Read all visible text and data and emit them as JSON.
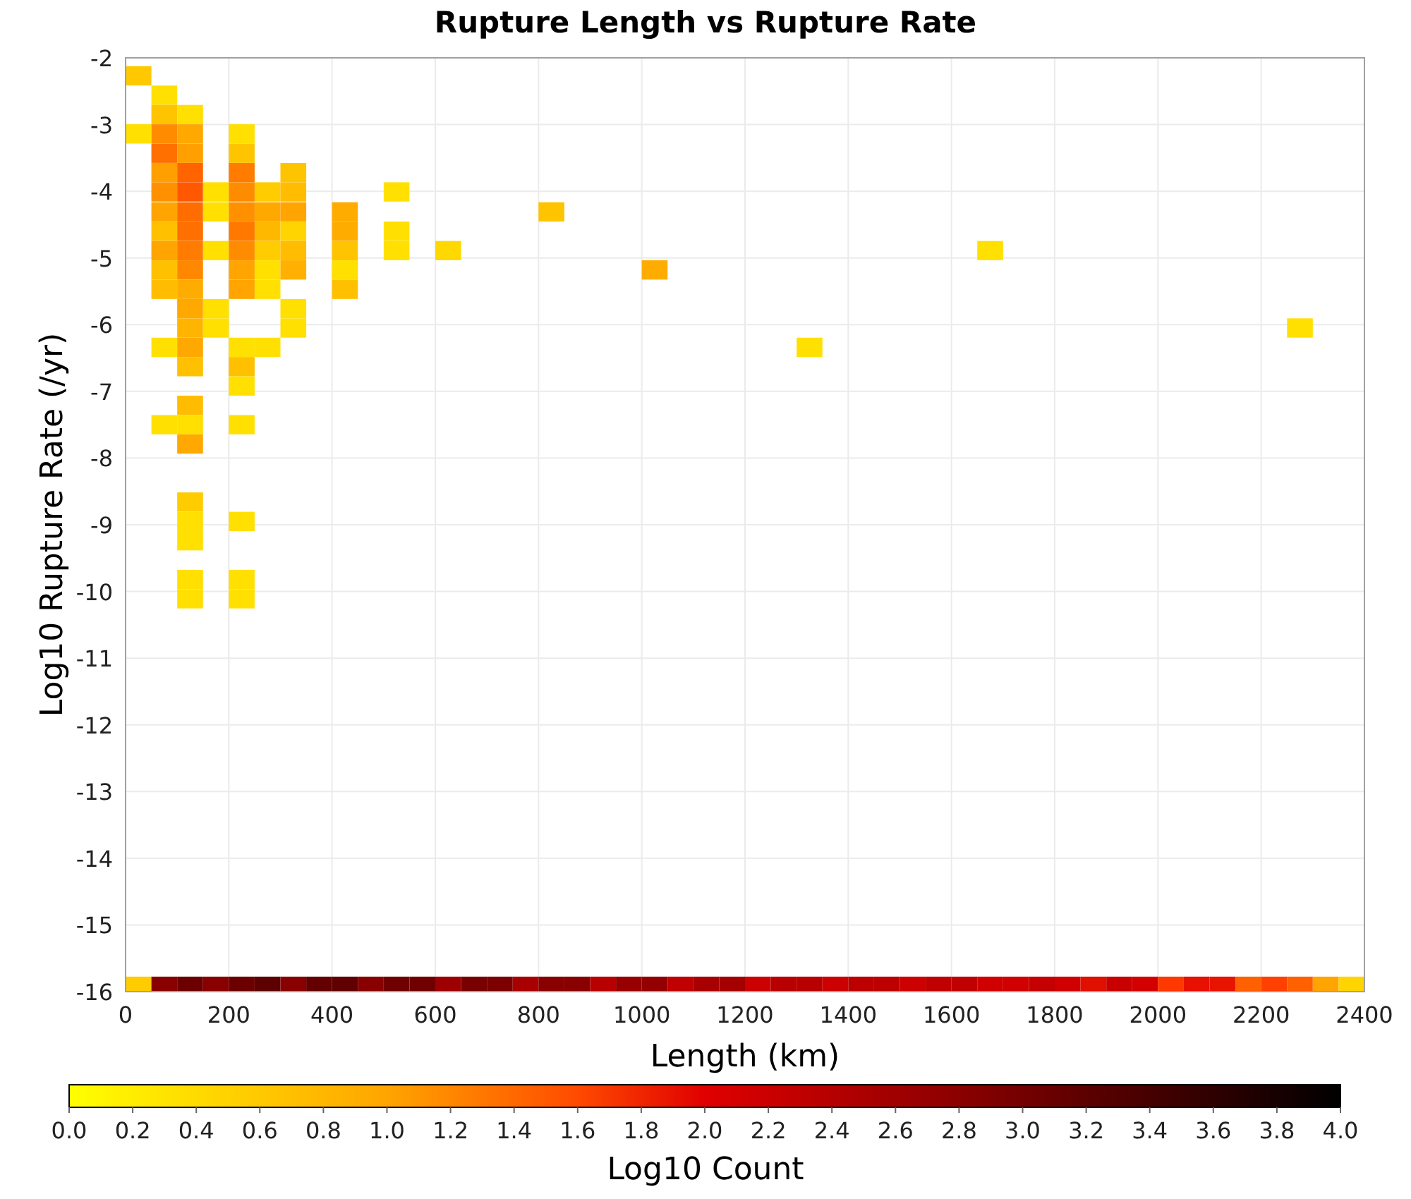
{
  "chart_data": {
    "type": "scatter",
    "title": "Rupture Length vs Rupture Rate",
    "xlabel": "Length (km)",
    "ylabel": "Log10 Rupture Rate (/yr)",
    "xlim": [
      0,
      2400
    ],
    "ylim": [
      -16,
      -2
    ],
    "xticks": [
      0,
      200,
      400,
      600,
      800,
      1000,
      1200,
      1400,
      1600,
      1800,
      2000,
      2200,
      2400
    ],
    "yticks": [
      -2,
      -3,
      -4,
      -5,
      -6,
      -7,
      -8,
      -9,
      -10,
      -11,
      -12,
      -13,
      -14,
      -15,
      -16
    ],
    "grid": true,
    "x": [
      25,
      75,
      75,
      125,
      25,
      75,
      125,
      225,
      75,
      125,
      225,
      75,
      125,
      225,
      325,
      75,
      125,
      175,
      225,
      275,
      325,
      525,
      75,
      125,
      175,
      225,
      275,
      325,
      425,
      825,
      75,
      125,
      225,
      275,
      325,
      425,
      525,
      75,
      125,
      175,
      225,
      275,
      325,
      425,
      525,
      625,
      1675,
      75,
      125,
      225,
      275,
      325,
      425,
      1025,
      75,
      125,
      225,
      275,
      425,
      125,
      175,
      325,
      125,
      175,
      325,
      2275,
      75,
      125,
      225,
      275,
      1325,
      125,
      225,
      225,
      125,
      75,
      125,
      225,
      125,
      125,
      125,
      225,
      125,
      125,
      225,
      125,
      225,
      25,
      75,
      125,
      175,
      225,
      275,
      325,
      375,
      425,
      475,
      525,
      575,
      625,
      675,
      725,
      775,
      825,
      875,
      925,
      975,
      1025,
      1075,
      1125,
      1175,
      1225,
      1275,
      1325,
      1375,
      1425,
      1475,
      1525,
      1575,
      1625,
      1675,
      1725,
      1775,
      1825,
      1875,
      1925,
      1975,
      2025,
      2075,
      2125,
      2175,
      2225,
      2275,
      2325,
      2375
    ],
    "series": [
      {
        "name": "Log10 Count",
        "values": [
          -2.27,
          -2.56,
          -2.85,
          -2.85,
          -3.14,
          -3.14,
          -3.14,
          -3.14,
          -3.43,
          -3.43,
          -3.43,
          -3.72,
          -3.72,
          -3.72,
          -3.72,
          -4.01,
          -4.01,
          -4.01,
          -4.01,
          -4.01,
          -4.01,
          -4.01,
          -4.31,
          -4.31,
          -4.31,
          -4.31,
          -4.31,
          -4.31,
          -4.31,
          -4.31,
          -4.6,
          -4.6,
          -4.6,
          -4.6,
          -4.6,
          -4.6,
          -4.6,
          -4.89,
          -4.89,
          -4.89,
          -4.89,
          -4.89,
          -4.89,
          -4.89,
          -4.89,
          -4.89,
          -4.89,
          -5.18,
          -5.18,
          -5.18,
          -5.18,
          -5.18,
          -5.18,
          -5.18,
          -5.47,
          -5.47,
          -5.47,
          -5.47,
          -5.47,
          -5.76,
          -5.76,
          -5.76,
          -6.05,
          -6.05,
          -6.05,
          -6.05,
          -6.34,
          -6.34,
          -6.34,
          -6.34,
          -6.34,
          -6.63,
          -6.63,
          -6.92,
          -7.21,
          -7.5,
          -7.5,
          -7.5,
          -7.79,
          -8.66,
          -8.95,
          -8.95,
          -9.24,
          -9.82,
          -9.82,
          -10.11,
          -10.11,
          -15.92,
          -15.92,
          -15.92,
          -15.92,
          -15.92,
          -15.92,
          -15.92,
          -15.92,
          -15.92,
          -15.92,
          -15.92,
          -15.92,
          -15.92,
          -15.92,
          -15.92,
          -15.92,
          -15.92,
          -15.92,
          -15.92,
          -15.92,
          -15.92,
          -15.92,
          -15.92,
          -15.92,
          -15.92,
          -15.92,
          -15.92,
          -15.92,
          -15.92,
          -15.92,
          -15.92,
          -15.92,
          -15.92,
          -15.92,
          -15.92,
          -15.92,
          -15.92,
          -15.92,
          -15.92,
          -15.92,
          -15.92,
          -15.92,
          -15.92,
          -15.92,
          -15.92,
          -15.92,
          -15.92,
          -15.92
        ]
      }
    ]
  },
  "cells": [
    {
      "color": "#ffc800"
    },
    {
      "color": "#ffe000"
    },
    {
      "color": "#ffc400"
    },
    {
      "color": "#ffe000"
    },
    {
      "color": "#ffe000"
    },
    {
      "color": "#ff8c00"
    },
    {
      "color": "#ffa800"
    },
    {
      "color": "#ffe000"
    },
    {
      "color": "#ff7000"
    },
    {
      "color": "#ffa000"
    },
    {
      "color": "#ffc400"
    },
    {
      "color": "#ffa000"
    },
    {
      "color": "#ff6400"
    },
    {
      "color": "#ff7c00"
    },
    {
      "color": "#ffc400"
    },
    {
      "color": "#ff9000"
    },
    {
      "color": "#ff5800"
    },
    {
      "color": "#ffe000"
    },
    {
      "color": "#ff8c00"
    },
    {
      "color": "#ffcc00"
    },
    {
      "color": "#ffbc00"
    },
    {
      "color": "#ffe000"
    },
    {
      "color": "#ffa400"
    },
    {
      "color": "#ff6c00"
    },
    {
      "color": "#ffe000"
    },
    {
      "color": "#ff9000"
    },
    {
      "color": "#ffa800"
    },
    {
      "color": "#ffa400"
    },
    {
      "color": "#ffac00"
    },
    {
      "color": "#ffc400"
    },
    {
      "color": "#ffc000"
    },
    {
      "color": "#ff7000"
    },
    {
      "color": "#ff7800"
    },
    {
      "color": "#ffb800"
    },
    {
      "color": "#ffd400"
    },
    {
      "color": "#ffac00"
    },
    {
      "color": "#ffe000"
    },
    {
      "color": "#ffa400"
    },
    {
      "color": "#ff7c00"
    },
    {
      "color": "#ffe000"
    },
    {
      "color": "#ff8c00"
    },
    {
      "color": "#ffcc00"
    },
    {
      "color": "#ffbc00"
    },
    {
      "color": "#ffc400"
    },
    {
      "color": "#ffe000"
    },
    {
      "color": "#ffd800"
    },
    {
      "color": "#ffe000"
    },
    {
      "color": "#ffc000"
    },
    {
      "color": "#ff8800"
    },
    {
      "color": "#ffa400"
    },
    {
      "color": "#ffe000"
    },
    {
      "color": "#ffb000"
    },
    {
      "color": "#ffe000"
    },
    {
      "color": "#ffac00"
    },
    {
      "color": "#ffbc00"
    },
    {
      "color": "#ffac00"
    },
    {
      "color": "#ffa400"
    },
    {
      "color": "#ffe000"
    },
    {
      "color": "#ffc000"
    },
    {
      "color": "#ffa800"
    },
    {
      "color": "#ffe000"
    },
    {
      "color": "#ffe000"
    },
    {
      "color": "#ffb400"
    },
    {
      "color": "#ffe000"
    },
    {
      "color": "#ffe000"
    },
    {
      "color": "#ffe000"
    },
    {
      "color": "#ffe000"
    },
    {
      "color": "#ffa800"
    },
    {
      "color": "#ffe000"
    },
    {
      "color": "#ffe000"
    },
    {
      "color": "#ffe000"
    },
    {
      "color": "#ffc000"
    },
    {
      "color": "#ffc000"
    },
    {
      "color": "#ffe000"
    },
    {
      "color": "#ffbc00"
    },
    {
      "color": "#ffe000"
    },
    {
      "color": "#ffe000"
    },
    {
      "color": "#ffe000"
    },
    {
      "color": "#ffa800"
    },
    {
      "color": "#ffcc00"
    },
    {
      "color": "#ffe000"
    },
    {
      "color": "#ffe000"
    },
    {
      "color": "#ffe000"
    },
    {
      "color": "#ffe000"
    },
    {
      "color": "#ffe000"
    },
    {
      "color": "#ffe000"
    },
    {
      "color": "#ffe000"
    },
    {
      "color": "#ffcc00"
    },
    {
      "color": "#880000"
    },
    {
      "color": "#6c0000"
    },
    {
      "color": "#880000"
    },
    {
      "color": "#6c0000"
    },
    {
      "color": "#5c0000"
    },
    {
      "color": "#880000"
    },
    {
      "color": "#640000"
    },
    {
      "color": "#600000"
    },
    {
      "color": "#880000"
    },
    {
      "color": "#700000"
    },
    {
      "color": "#700000"
    },
    {
      "color": "#9c0000"
    },
    {
      "color": "#780000"
    },
    {
      "color": "#7c0000"
    },
    {
      "color": "#a80000"
    },
    {
      "color": "#880000"
    },
    {
      "color": "#880000"
    },
    {
      "color": "#b80000"
    },
    {
      "color": "#980000"
    },
    {
      "color": "#940000"
    },
    {
      "color": "#c00000"
    },
    {
      "color": "#a80000"
    },
    {
      "color": "#a40000"
    },
    {
      "color": "#cc0000"
    },
    {
      "color": "#b80000"
    },
    {
      "color": "#b80000"
    },
    {
      "color": "#cc0000"
    },
    {
      "color": "#bc0000"
    },
    {
      "color": "#bc0000"
    },
    {
      "color": "#cc0000"
    },
    {
      "color": "#c00000"
    },
    {
      "color": "#c00000"
    },
    {
      "color": "#d00000"
    },
    {
      "color": "#d00000"
    },
    {
      "color": "#c40000"
    },
    {
      "color": "#d00000"
    },
    {
      "color": "#e01000"
    },
    {
      "color": "#c80000"
    },
    {
      "color": "#d40000"
    },
    {
      "color": "#ff3800"
    },
    {
      "color": "#e81000"
    },
    {
      "color": "#e81400"
    },
    {
      "color": "#ff6000"
    },
    {
      "color": "#ff4000"
    },
    {
      "color": "#ff6000"
    },
    {
      "color": "#ffa400"
    },
    {
      "color": "#ffd400"
    }
  ],
  "color_scale": {
    "ticks": [
      "0.0",
      "0.2",
      "0.4",
      "0.6",
      "0.8",
      "1.0",
      "1.2",
      "1.4",
      "1.6",
      "1.8",
      "2.0",
      "2.2",
      "2.4",
      "2.6",
      "2.8",
      "3.0",
      "3.2",
      "3.4",
      "3.6",
      "3.8",
      "4.0"
    ]
  }
}
